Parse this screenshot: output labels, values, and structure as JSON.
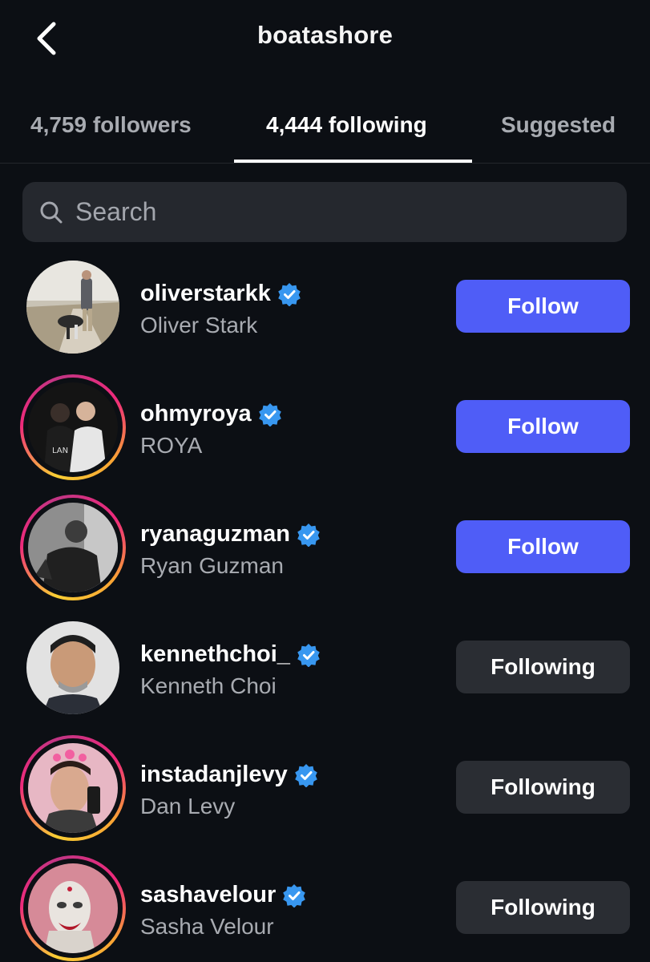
{
  "header": {
    "title": "boatashore",
    "back_icon": "chevron-left-icon"
  },
  "tabs": [
    {
      "label": "4,759 followers",
      "active": false
    },
    {
      "label": "4,444 following",
      "active": true
    },
    {
      "label": "Suggested",
      "active": false
    }
  ],
  "search": {
    "placeholder": "Search",
    "icon": "search-icon"
  },
  "colors": {
    "background": "#0c0f14",
    "follow_button": "#4f5df7",
    "following_button": "#2a2d33",
    "verified_badge": "#3897f0"
  },
  "accounts": [
    {
      "username": "oliverstarkk",
      "name": "Oliver Stark",
      "verified": true,
      "story_ring": false,
      "button": "Follow"
    },
    {
      "username": "ohmyroya",
      "name": "ROYA",
      "verified": true,
      "story_ring": true,
      "button": "Follow"
    },
    {
      "username": "ryanaguzman",
      "name": "Ryan Guzman",
      "verified": true,
      "story_ring": true,
      "button": "Follow"
    },
    {
      "username": "kennethchoi_",
      "name": "Kenneth Choi",
      "verified": true,
      "story_ring": false,
      "button": "Following"
    },
    {
      "username": "instadanjlevy",
      "name": "Dan Levy",
      "verified": true,
      "story_ring": true,
      "button": "Following"
    },
    {
      "username": "sashavelour",
      "name": "Sasha Velour",
      "verified": true,
      "story_ring": true,
      "button": "Following"
    }
  ]
}
